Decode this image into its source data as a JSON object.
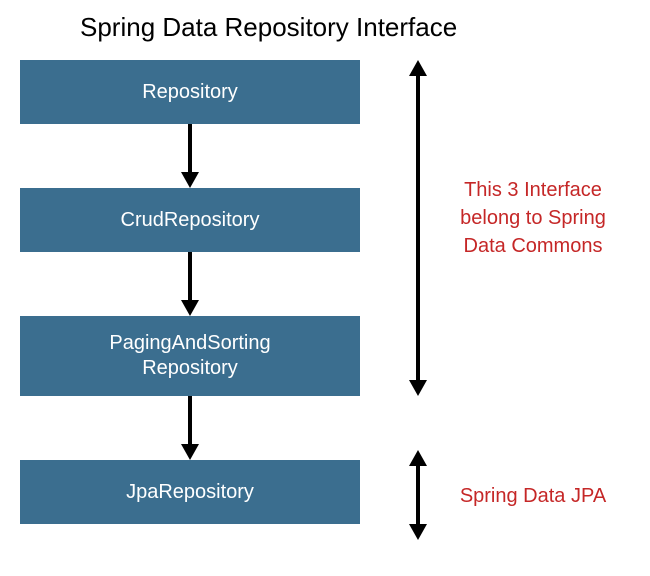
{
  "title": "Spring Data Repository Interface",
  "boxes": {
    "b1": "Repository",
    "b2": "CrudRepository",
    "b3_line1": "PagingAndSorting",
    "b3_line2": "Repository",
    "b4": "JpaRepository"
  },
  "annotations": {
    "a1_line1": "This 3 Interface",
    "a1_line2": "belong to Spring",
    "a1_line3": "Data Commons",
    "a2": "Spring Data JPA"
  },
  "colors": {
    "box_bg": "#3b6e8f",
    "box_text": "#ffffff",
    "annotation": "#c52727",
    "title": "#000000",
    "arrow": "#000000"
  }
}
